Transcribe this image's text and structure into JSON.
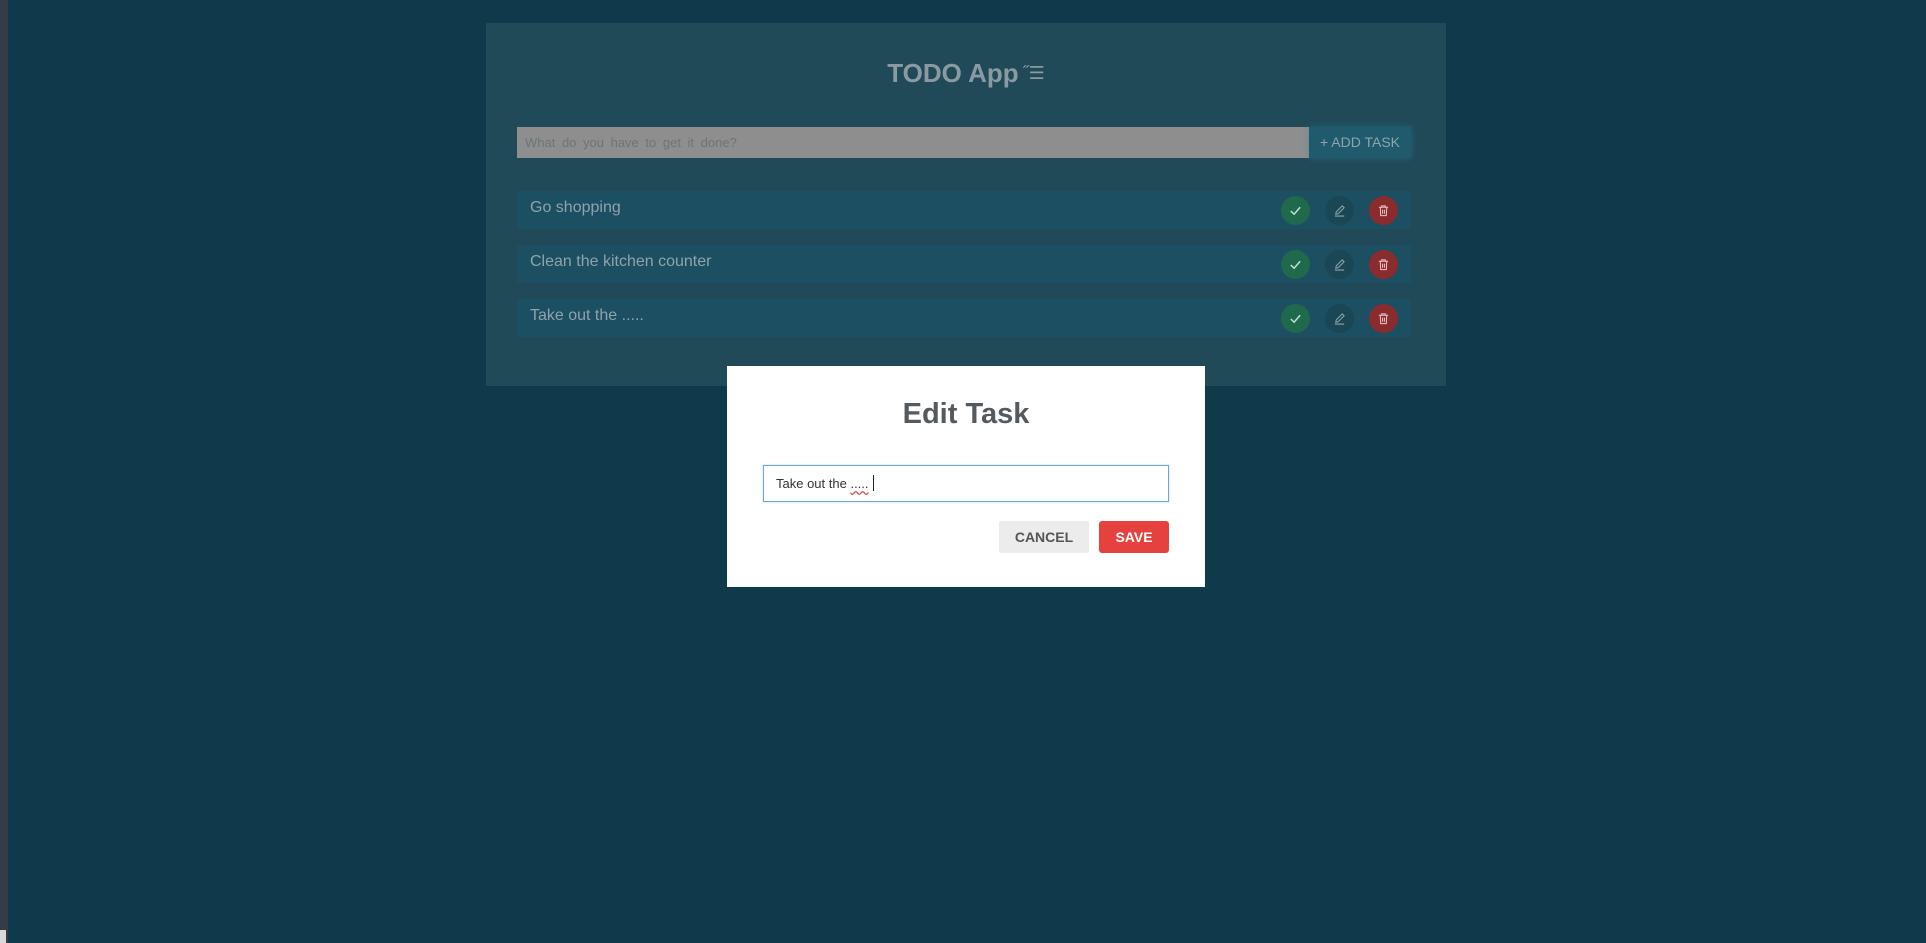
{
  "app": {
    "title": "TODO App",
    "title_icon": "list-icon"
  },
  "new_task": {
    "placeholder": "What do you have to get it done?",
    "value": "",
    "add_label": "+ ADD TASK"
  },
  "tasks": [
    {
      "text": "Go shopping"
    },
    {
      "text": "Clean the kitchen counter"
    },
    {
      "text": "Take out the ....."
    }
  ],
  "task_action_icons": [
    "check-icon",
    "pencil-icon",
    "trash-icon"
  ],
  "modal": {
    "title": "Edit Task",
    "input_prefix": "Take out the ",
    "input_misspelled": ".....",
    "cancel_label": "CANCEL",
    "save_label": "SAVE"
  },
  "colors": {
    "background": "#0f3a4c",
    "card": "#214a59",
    "done": "#1f6a4c",
    "delete": "#8a2b2e",
    "save": "#e5423f"
  }
}
